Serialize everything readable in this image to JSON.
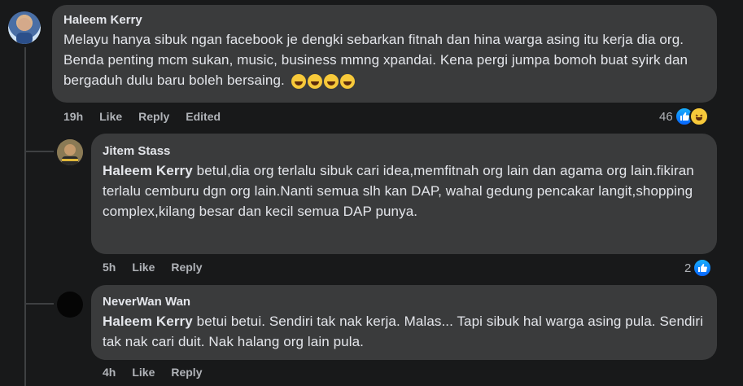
{
  "comments": [
    {
      "author": "Haleem Kerry",
      "body": "Melayu hanya sibuk ngan facebook je dengki sebarkan fitnah dan hina warga asing itu kerja dia org. Benda penting mcm sukan, music, business mmng xpandai. Kena pergi jumpa bomoh buat syirk dan bergaduh dulu baru boleh bersaing.",
      "emoji": "rolling-on-floor-laughing x4",
      "time": "19h",
      "like": "Like",
      "reply": "Reply",
      "edited": "Edited",
      "reaction_count": "46",
      "reactions": [
        "like-icon",
        "haha-icon"
      ]
    },
    {
      "author": "Jitem Stass",
      "mention": "Haleem Kerry",
      "body": "betul,dia org terlalu sibuk cari idea,memfitnah org lain dan agama org lain.fikiran terlalu cemburu dgn org lain.Nanti semua slh kan DAP, wahal gedung pencakar langit,shopping complex,kilang besar dan kecil semua DAP punya.",
      "time": "5h",
      "like": "Like",
      "reply": "Reply",
      "reaction_count": "2",
      "reactions": [
        "like-icon"
      ]
    },
    {
      "author": "NeverWan Wan",
      "mention": "Haleem Kerry",
      "body": "betui betui. Sendiri tak nak kerja. Malas... Tapi sibuk hal warga asing pula. Sendiri tak nak cari duit. Nak halang org lain pula.",
      "time": "4h",
      "like": "Like",
      "reply": "Reply"
    }
  ],
  "colors": {
    "background": "#18191a",
    "bubble": "#3a3b3c",
    "text": "#e4e6eb",
    "secondary": "#b0b3b8",
    "like_blue": "#0866ff"
  }
}
